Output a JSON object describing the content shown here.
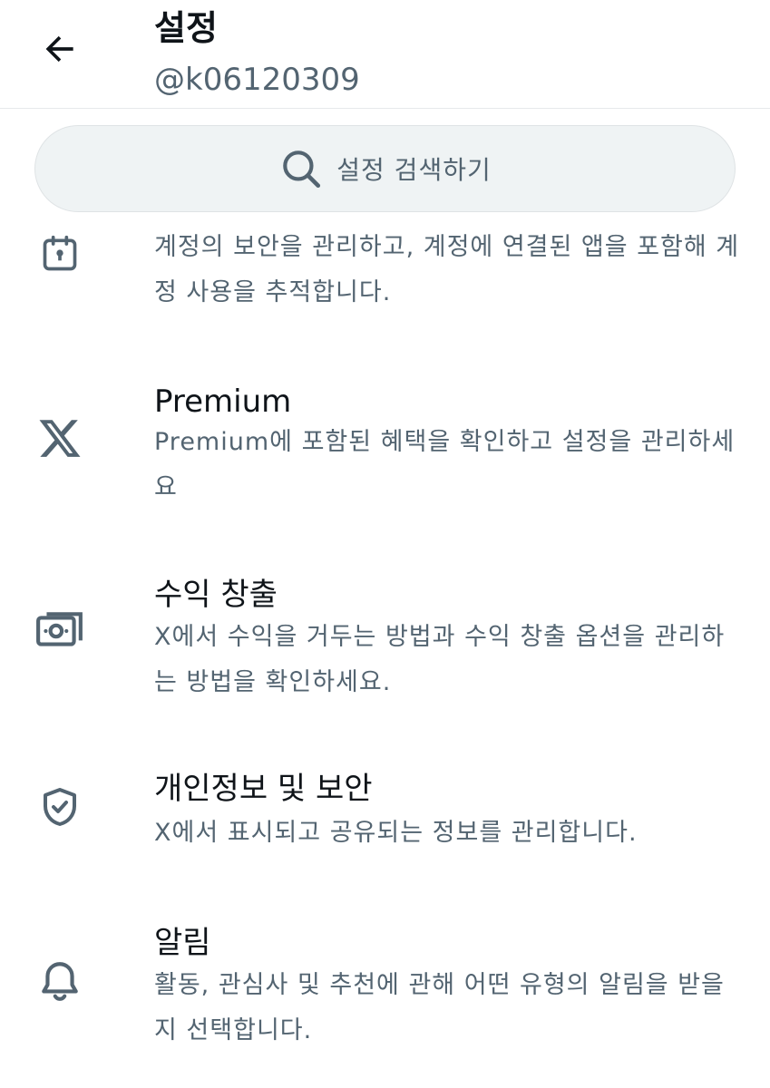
{
  "header": {
    "title": "설정",
    "handle": "@k06120309"
  },
  "search": {
    "placeholder": "설정 검색하기"
  },
  "settings": [
    {
      "title": "",
      "description": "계정의 보안을 관리하고, 계정에 연결된 앱을 포함해 계정 사용을 추적합니다.",
      "icon": "lock-calendar-icon"
    },
    {
      "title": "Premium",
      "description": "Premium에 포함된 혜택을 확인하고 설정을 관리하세요",
      "icon": "x-logo-icon"
    },
    {
      "title": "수익 창출",
      "description": "X에서 수익을 거두는 방법과 수익 창출 옵션을 관리하는 방법을 확인하세요.",
      "icon": "money-icon"
    },
    {
      "title": "개인정보 및 보안",
      "description": "X에서 표시되고 공유되는 정보를 관리합니다.",
      "icon": "shield-check-icon"
    },
    {
      "title": "알림",
      "description": "활동, 관심사 및 추천에 관해 어떤 유형의 알림을 받을지 선택합니다.",
      "icon": "bell-icon"
    }
  ]
}
